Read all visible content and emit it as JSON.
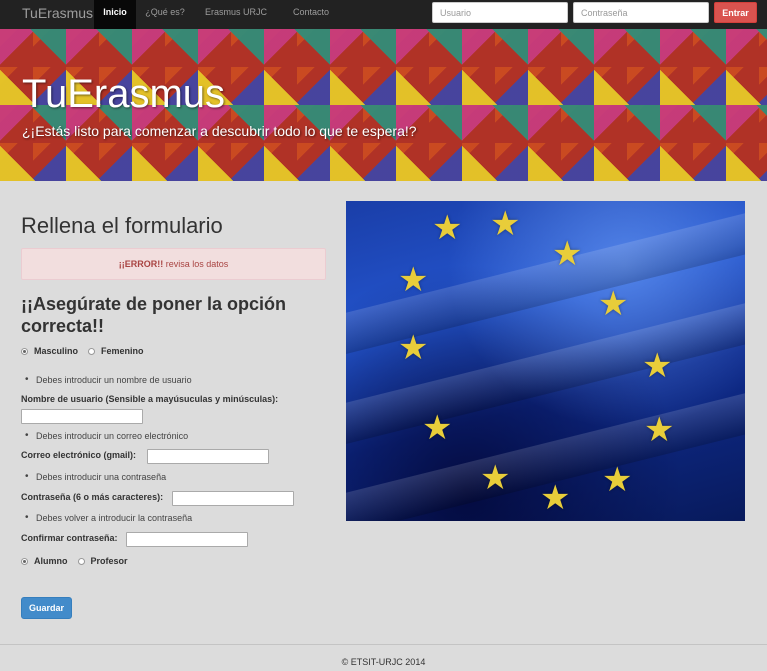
{
  "navbar": {
    "brand": "TuErasmus",
    "items": [
      {
        "label": "Inicio",
        "active": true
      },
      {
        "label": "¿Qué es?",
        "active": false
      },
      {
        "label": "Erasmus URJC",
        "active": false
      },
      {
        "label": "Contacto",
        "active": false
      }
    ],
    "username_placeholder": "Usuario",
    "password_placeholder": "Contraseña",
    "login_label": "Entrar",
    "login_color": "#d9534f"
  },
  "hero": {
    "title": "TuErasmus",
    "subtitle": "¿¡Estás listo para comenzar a descubrir todo lo que te espera!?"
  },
  "form": {
    "title": "Rellena el formulario",
    "alert": {
      "strong": "¡¡ERROR!!",
      "text": " revisa los datos"
    },
    "heading": "¡¡Asegúrate de poner la opción correcta!!",
    "gender_options": [
      {
        "label": "Masculino",
        "checked": true
      },
      {
        "label": "Femenino",
        "checked": false
      }
    ],
    "username": {
      "error": "Debes introducir un nombre de usuario",
      "label": "Nombre de usuario (Sensible a mayúsuculas y minúsculas):",
      "value": ""
    },
    "email": {
      "error": "Debes introducir un correo electrónico",
      "label": "Correo electrónico (gmail):",
      "value": ""
    },
    "password": {
      "error": "Debes introducir una contraseña",
      "label": "Contraseña (6 o más caracteres):",
      "value": ""
    },
    "confirm": {
      "error": "Debes volver a introducir la contraseña",
      "label": "Confirmar contraseña:",
      "value": ""
    },
    "role_options": [
      {
        "label": "Alumno",
        "checked": true
      },
      {
        "label": "Profesor",
        "checked": false
      }
    ],
    "save_label": "Guardar",
    "save_color": "#428bca"
  },
  "image": {
    "icon": "eu-flag-image",
    "star_glyph": "★",
    "star_color": "#e8cd3a"
  },
  "footer": {
    "text": "© ETSIT-URJC 2014"
  }
}
